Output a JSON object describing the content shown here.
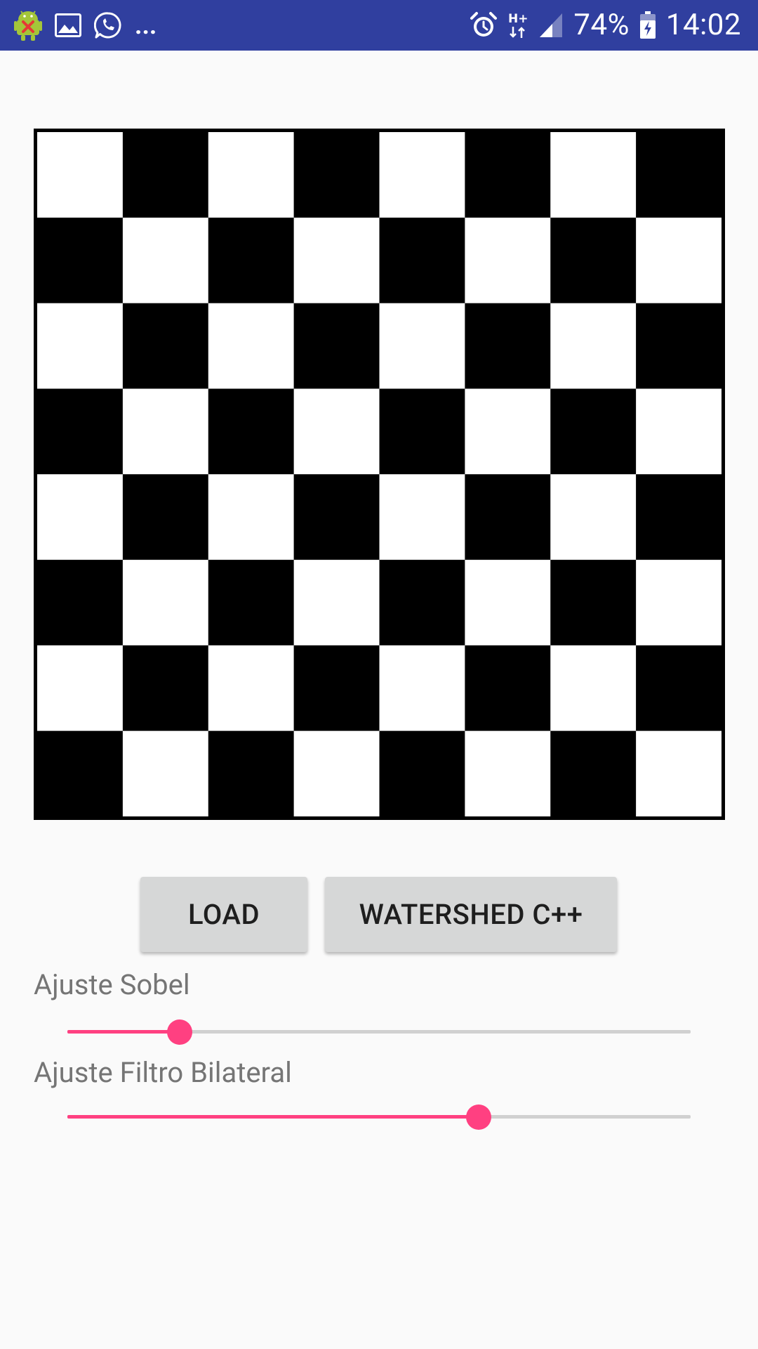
{
  "status_bar": {
    "notification_icons": [
      "android-debug-icon",
      "image-icon",
      "whatsapp-icon"
    ],
    "overflow": "...",
    "network": "H+",
    "battery": "74%",
    "time": "14:02"
  },
  "board": {
    "rows": 8,
    "cols": 8,
    "colors": [
      "#FFFFFF",
      "#000000"
    ]
  },
  "buttons": {
    "load_label": "LOAD",
    "watershed_label": "WATERSHED C++"
  },
  "sliders": {
    "sobel": {
      "label": "Ajuste Sobel",
      "value": 0.18
    },
    "bilateral": {
      "label": "Ajuste Filtro Bilateral",
      "value": 0.66
    }
  },
  "colors": {
    "status_bar": "#303F9F",
    "accent": "#FF4081",
    "button": "#D6D7D7",
    "background": "#FAFAFA"
  }
}
